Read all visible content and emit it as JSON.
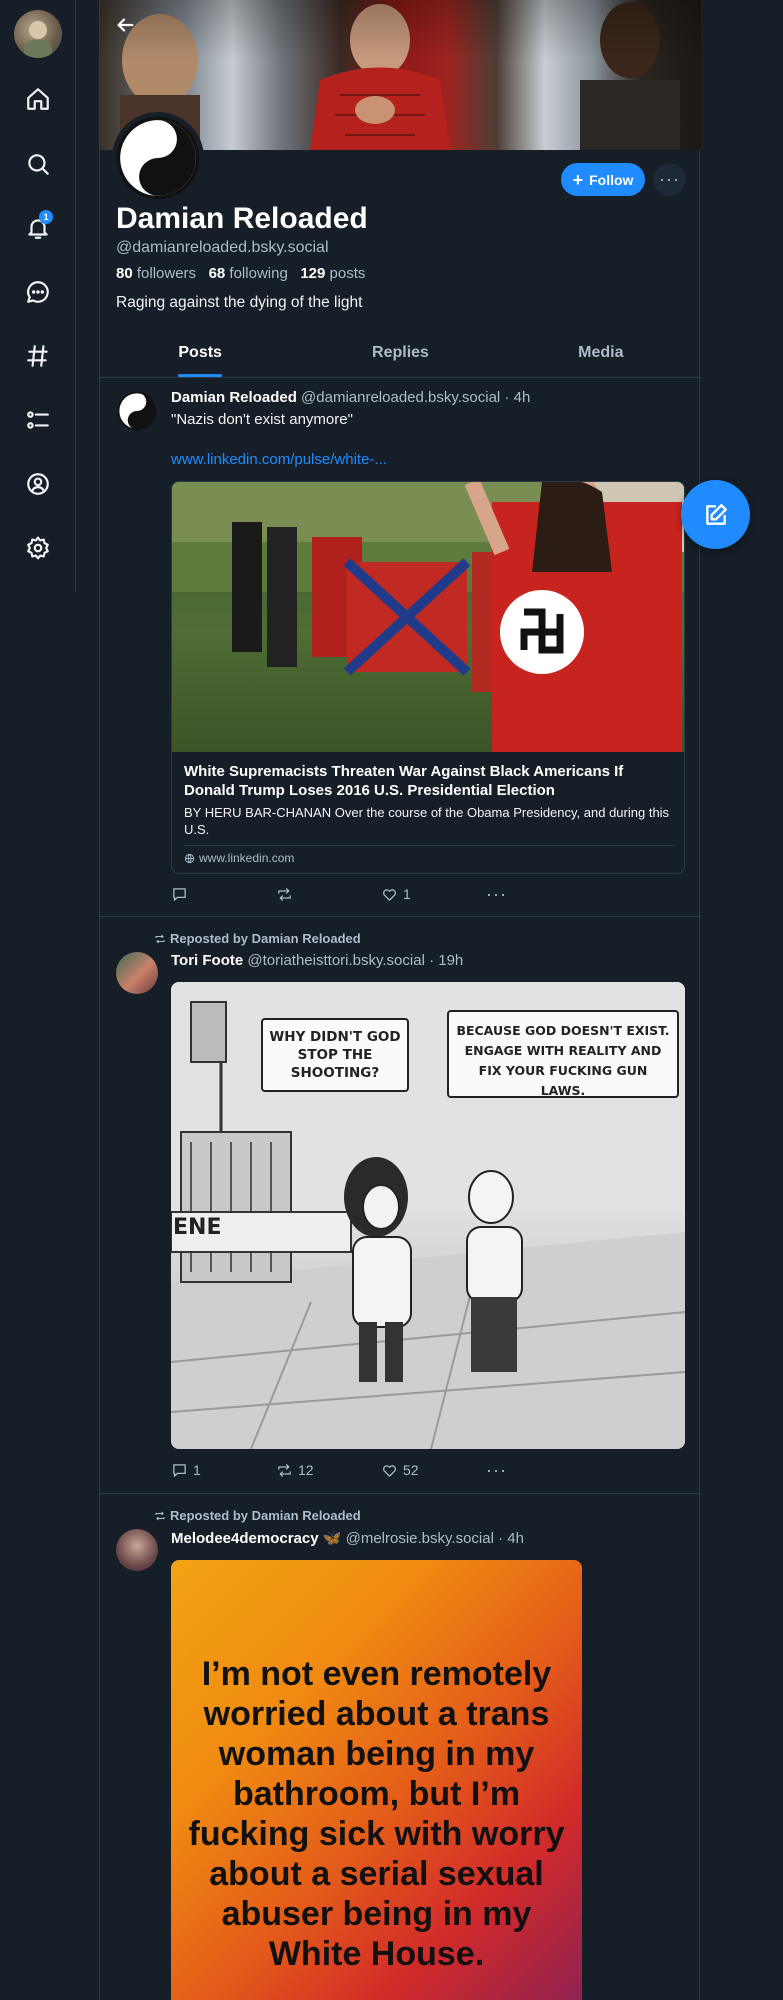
{
  "nav": {
    "notifications_badge": "1",
    "items": [
      "home",
      "search",
      "notifications",
      "chat",
      "feeds",
      "lists",
      "profile",
      "settings"
    ]
  },
  "profile": {
    "display_name": "Damian Reloaded",
    "handle": "@damianreloaded.bsky.social",
    "followers_count": "80",
    "followers_label": "followers",
    "following_count": "68",
    "following_label": "following",
    "posts_count": "129",
    "posts_label": "posts",
    "bio": "Raging against the dying of the light",
    "follow_label": "Follow",
    "more_label": "···"
  },
  "tabs": [
    {
      "label": "Posts",
      "active": true
    },
    {
      "label": "Replies",
      "active": false
    },
    {
      "label": "Media",
      "active": false
    }
  ],
  "posts": [
    {
      "author_name": "Damian Reloaded",
      "author_handle": "@damianreloaded.bsky.social · 4h",
      "text": "\"Nazis don't exist anymore\"",
      "link": "www.linkedin.com/pulse/white-...",
      "card": {
        "title": "White Supremacists Threaten War Against Black Americans If Donald Trump Loses 2016 U.S. Presidential Election",
        "description": "BY HERU BAR-CHANAN Over the course of the Obama Presidency, and during this U.S.",
        "domain": "www.linkedin.com"
      },
      "replies": "",
      "reposts": "",
      "likes": "1"
    },
    {
      "repost_by": "Reposted by Damian Reloaded",
      "author_name": "Tori Foote",
      "author_handle": "@toriatheisttori.bsky.social · 19h",
      "image_text": {
        "bubble_left": "Why didn't God stop the shooting?",
        "bubble_right": "Because God doesn't exist. Engage with reality and fix your fucking gun laws.",
        "sign": "ENE"
      },
      "replies": "1",
      "reposts": "12",
      "likes": "52"
    },
    {
      "repost_by": "Reposted by Damian Reloaded",
      "author_name": "Melodee4democracy",
      "author_emoji": "🦋",
      "author_handle": "@melrosie.bsky.social · 4h",
      "image_text": {
        "quote": "I’m not even remotely worried about a trans woman being in my bathroom, but I’m fucking sick with worry about a serial sexual abuser being in my White House."
      }
    }
  ]
}
